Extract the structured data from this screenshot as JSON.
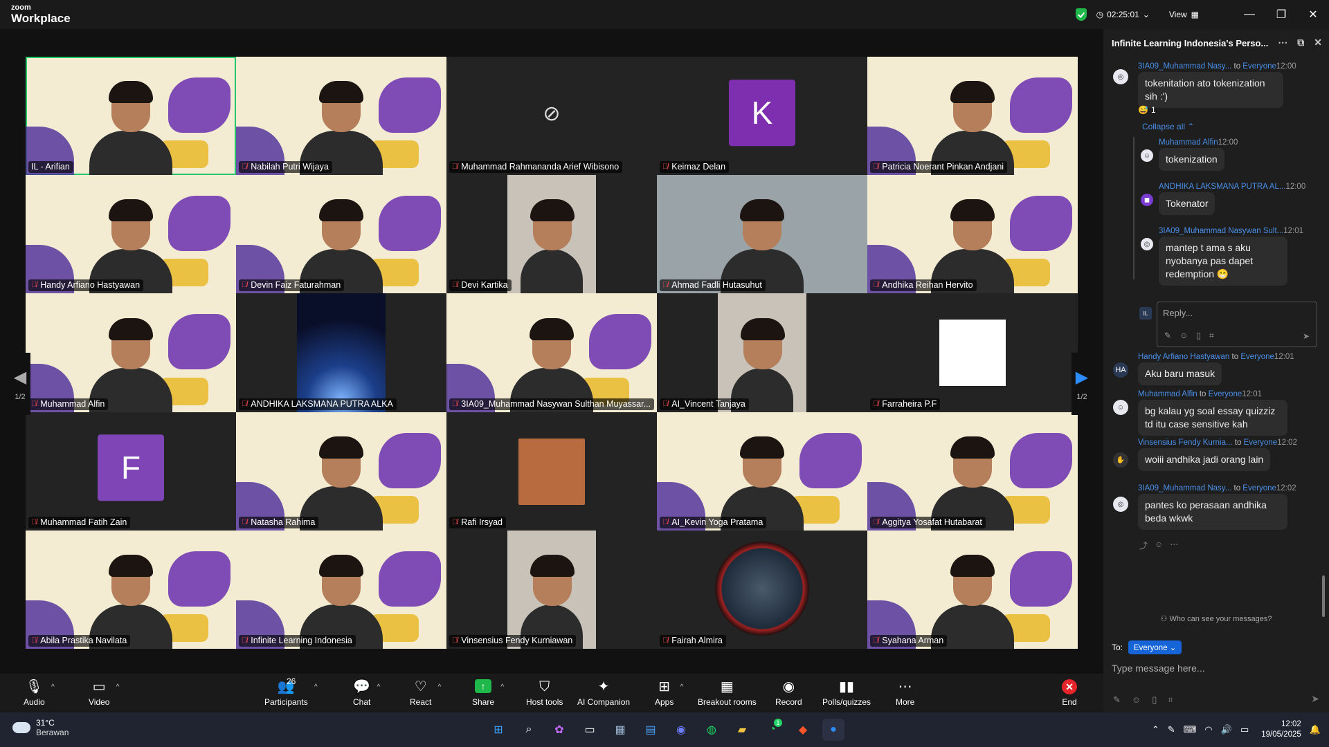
{
  "app": {
    "brand_top": "zoom",
    "brand_bottom": "Workplace"
  },
  "titlebar": {
    "timer": "02:25:01",
    "view_label": "View"
  },
  "participants": [
    {
      "name": "IL - Arifian",
      "style": "banner",
      "active": true,
      "muted": false
    },
    {
      "name": "Nabilah Putri Wijaya",
      "style": "banner",
      "muted": true
    },
    {
      "name": "Muhammad Rahmananda Arief Wibisono",
      "style": "camoff",
      "muted": true
    },
    {
      "name": "Keimaz Delan",
      "style": "avatar",
      "initial": "K",
      "muted": true
    },
    {
      "name": "Patricia Noerant Pinkan Andjani",
      "style": "banner",
      "muted": true
    },
    {
      "name": "Handy Arfiano Hastyawan",
      "style": "banner",
      "muted": true
    },
    {
      "name": "Devin Faiz Faturahman",
      "style": "banner",
      "muted": true
    },
    {
      "name": "Devi Kartika",
      "style": "center",
      "muted": true
    },
    {
      "name": "Ahmad Fadli Hutasuhut",
      "style": "photo",
      "muted": true
    },
    {
      "name": "Andhika Reihan Hervito",
      "style": "banner",
      "muted": true
    },
    {
      "name": "Muhammad Alfin",
      "style": "banner",
      "muted": true
    },
    {
      "name": "ANDHIKA LAKSMANA PUTRA ALKA",
      "style": "space",
      "muted": true
    },
    {
      "name": "3IA09_Muhammad Nasywan Sulthan Muyassar...",
      "style": "banner",
      "muted": true
    },
    {
      "name": "AI_Vincent Tanjaya",
      "style": "center",
      "muted": true
    },
    {
      "name": "Farraheira P.F",
      "style": "stars",
      "muted": true
    },
    {
      "name": "Muhammad Fatih Zain",
      "style": "avatar",
      "initial": "F",
      "muted": true
    },
    {
      "name": "Natasha Rahima",
      "style": "banner",
      "muted": true
    },
    {
      "name": "Rafi Irsyad",
      "style": "smallphoto",
      "muted": true
    },
    {
      "name": "AI_Kevin Yoga Pratama",
      "style": "banner",
      "muted": true
    },
    {
      "name": "Aggitya Yosafat Hutabarat",
      "style": "banner",
      "muted": true
    },
    {
      "name": "Abila Prastika Navilata",
      "style": "banner",
      "muted": true
    },
    {
      "name": "Infinite Learning Indonesia",
      "style": "banner",
      "muted": true
    },
    {
      "name": "Vinsensius Fendy Kurniawan",
      "style": "center",
      "muted": true
    },
    {
      "name": "Fairah Almira",
      "style": "circle",
      "muted": true
    },
    {
      "name": "Syahana Arman",
      "style": "banner",
      "muted": true
    }
  ],
  "pager": {
    "left": "1/2",
    "right": "1/2"
  },
  "toolbar": {
    "audio": "Audio",
    "video": "Video",
    "participants": "Participants",
    "participants_count": "26",
    "chat": "Chat",
    "react": "React",
    "share": "Share",
    "host_tools": "Host tools",
    "ai_companion": "AI Companion",
    "apps": "Apps",
    "breakout": "Breakout rooms",
    "record": "Record",
    "polls": "Polls/quizzes",
    "more": "More",
    "end": "End"
  },
  "chat": {
    "title": "Infinite Learning Indonesia's Perso...",
    "messages": [
      {
        "sender": "3IA09_Muhammad Nasy...",
        "to": "to",
        "audience": "Everyone",
        "time": "12:00",
        "text": "tokenitation ato tokenization sih :')"
      },
      {
        "reaction_count": "1"
      },
      {
        "collapse": "Collapse all"
      },
      {
        "sender": "Muhammad Alfin",
        "time": "12:00",
        "text": "tokenization"
      },
      {
        "sender": "ANDHIKA LAKSMANA PUTRA AL...",
        "time": "12:00",
        "text": "Tokenator"
      },
      {
        "sender": "3IA09_Muhammad Nasywan Sult...",
        "time": "12:01",
        "text": "mantep t ama s aku nyobanya pas dapet redemption 😁"
      },
      {
        "reply_placeholder": "Reply..."
      },
      {
        "sender": "Handy Arfiano Hastyawan",
        "to": "to",
        "audience": "Everyone",
        "time": "12:01",
        "text": "Aku baru masuk",
        "initials": "HA"
      },
      {
        "sender": "Muhammad Alfin",
        "to": "to",
        "audience": "Everyone",
        "time": "12:01",
        "text": "bg kalau yg soal essay quizziz td itu case sensitive kah"
      },
      {
        "sender": "Vinsensius Fendy Kurnia...",
        "to": "to",
        "audience": "Everyone",
        "time": "12:02",
        "text": "woiii andhika jadi orang lain"
      },
      {
        "sender": "3IA09_Muhammad Nasy...",
        "to": "to",
        "audience": "Everyone",
        "time": "12:02",
        "text": "pantes ko perasaan andhika beda wkwk"
      }
    ],
    "who_can_see": "Who can see your messages?",
    "to_label": "To:",
    "to_value": "Everyone",
    "input_placeholder": "Type message here..."
  },
  "taskbar": {
    "temp": "31°C",
    "weather": "Berawan",
    "time": "12:02",
    "date": "19/05/2025",
    "whatsapp_badge": "1"
  }
}
